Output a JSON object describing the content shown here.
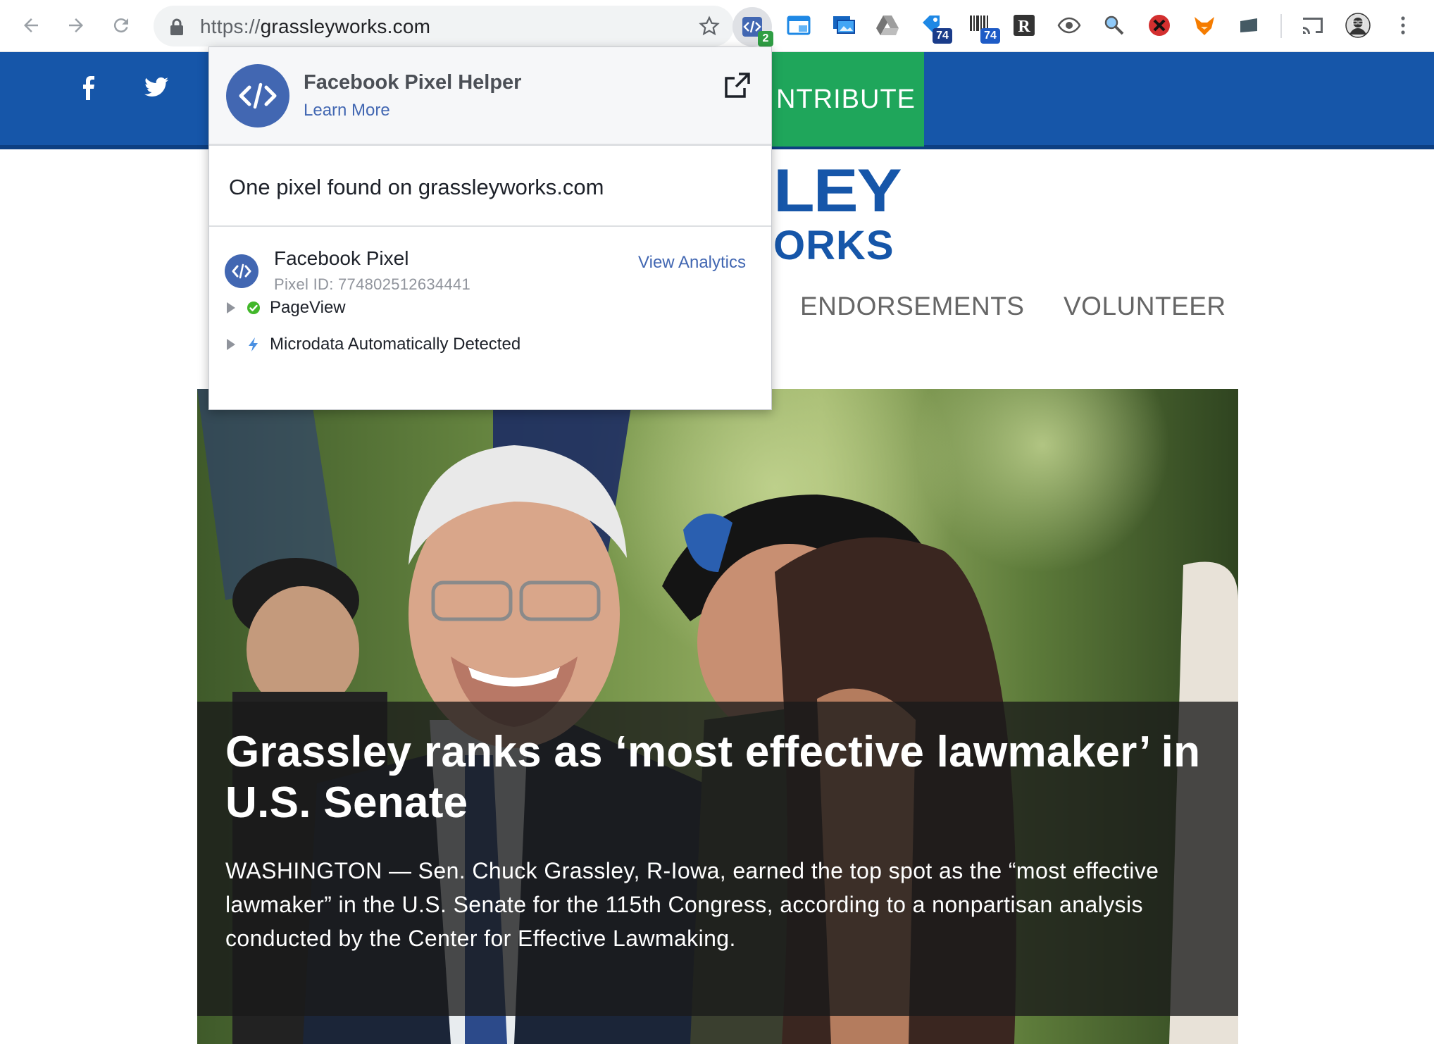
{
  "browser": {
    "url_scheme": "https://",
    "url_host": "grassleyworks.com",
    "extension_badges": {
      "pixel_helper": "2",
      "ext_a": "74",
      "ext_b": "74"
    }
  },
  "site": {
    "contribute_label": "NTRIBUTE",
    "logo_line1": "LEY",
    "logo_line2": "ORKS",
    "nav": {
      "endorsements": "ENDORSEMENTS",
      "volunteer": "VOLUNTEER"
    },
    "hero": {
      "title": "Grassley ranks as ‘most effective lawmaker’ in U.S. Senate",
      "body": "WASHINGTON — Sen. Chuck Grassley, R-Iowa, earned the top spot as the “most effective lawmaker” in the U.S. Senate for the 115th Congress, according to a nonpartisan analysis conducted by the Center for Effective Lawmaking."
    }
  },
  "popup": {
    "title": "Facebook Pixel Helper",
    "learn_more": "Learn More",
    "summary": "One pixel found on grassleyworks.com",
    "pixel": {
      "name": "Facebook Pixel",
      "id_text": "Pixel ID: 774802512634441",
      "view_analytics": "View Analytics"
    },
    "events": [
      {
        "label": "PageView",
        "status": "success"
      },
      {
        "label": "Microdata Automatically Detected",
        "status": "info"
      }
    ]
  },
  "colors": {
    "site_blue": "#1656a9",
    "contribute_green": "#1fa65b",
    "facebook_blue": "#4267b2",
    "success_green": "#42b72a"
  },
  "icons": [
    "back-arrow-icon",
    "forward-arrow-icon",
    "reload-icon",
    "lock-icon",
    "star-icon",
    "facebook-icon",
    "twitter-icon",
    "code-icon",
    "external-link-icon",
    "caret-right-icon",
    "check-circle-icon",
    "lightning-icon",
    "cast-icon",
    "more-vert-icon"
  ]
}
